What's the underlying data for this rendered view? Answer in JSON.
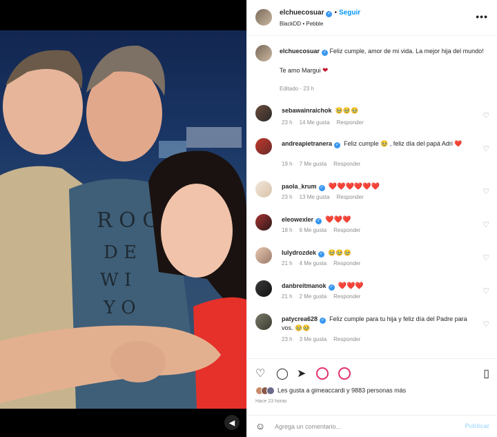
{
  "post": {
    "username": "elchuecosuar",
    "follow_label": "Seguir",
    "dot": "•",
    "subtitle": "BlackDD • Pebble",
    "more": "•••"
  },
  "caption": {
    "username": "elchuecosuar",
    "text_1": "Feliz cumple, amor de mi vida. La mejor hija del mundo!",
    "text_2": "Te amo Margui",
    "meta": "Editado · 23 h"
  },
  "comments": [
    {
      "username": "sebawainraichok",
      "text": "🥹🥹🥹",
      "time": "23 h",
      "likes": "14 Me gusta",
      "reply": "Responder",
      "verified": false
    },
    {
      "username": "andreapietranera",
      "text": "Feliz cumple 🥹 , feliz día del papá Adri ❤️",
      "time": "19 h",
      "likes": "7 Me gusta",
      "reply": "Responder",
      "verified": true
    },
    {
      "username": "paola_krum",
      "text": "❤️❤️❤️❤️❤️❤️",
      "time": "23 h",
      "likes": "13 Me gusta",
      "reply": "Responder",
      "verified": true
    },
    {
      "username": "eleowexler",
      "text": "❤️❤️❤️",
      "time": "18 h",
      "likes": "6 Me gusta",
      "reply": "Responder",
      "verified": true
    },
    {
      "username": "lulydrozdek",
      "text": "🥹🥹🥹",
      "time": "21 h",
      "likes": "4 Me gusta",
      "reply": "Responder",
      "verified": true
    },
    {
      "username": "danbreitmanok",
      "text": "❤️❤️❤️",
      "time": "21 h",
      "likes": "2 Me gusta",
      "reply": "Responder",
      "verified": true
    },
    {
      "username": "patycrea628",
      "text": "Feliz cumple para tu hija y feliz día del Padre para vos. 🥹🥹",
      "time": "23 h",
      "likes": "3 Me gusta",
      "reply": "Responder",
      "verified": true
    }
  ],
  "likes_text": "Les gusta a gimeaccardi y 9883 personas más",
  "time_ago": "Hace 23 horas",
  "comment_placeholder": "Agrega un comentario...",
  "publish_label": "Publicar",
  "colors": {
    "accent": "#0095f6",
    "heart": "#c4132c",
    "muted": "#8e8e8e"
  },
  "icons": [
    "heart-icon",
    "comment-icon",
    "share-icon",
    "story-icon",
    "story-icon",
    "bookmark-icon",
    "emoji-icon",
    "mute-icon"
  ]
}
